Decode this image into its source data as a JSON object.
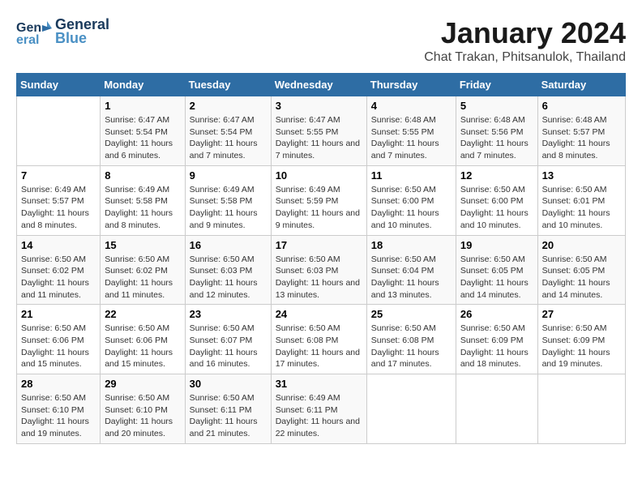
{
  "header": {
    "logo_line1": "General",
    "logo_line2": "Blue",
    "title": "January 2024",
    "subtitle": "Chat Trakan, Phitsanulok, Thailand"
  },
  "calendar": {
    "days_of_week": [
      "Sunday",
      "Monday",
      "Tuesday",
      "Wednesday",
      "Thursday",
      "Friday",
      "Saturday"
    ],
    "weeks": [
      [
        {
          "day": "",
          "info": ""
        },
        {
          "day": "1",
          "info": "Sunrise: 6:47 AM\nSunset: 5:54 PM\nDaylight: 11 hours and 6 minutes."
        },
        {
          "day": "2",
          "info": "Sunrise: 6:47 AM\nSunset: 5:54 PM\nDaylight: 11 hours and 7 minutes."
        },
        {
          "day": "3",
          "info": "Sunrise: 6:47 AM\nSunset: 5:55 PM\nDaylight: 11 hours and 7 minutes."
        },
        {
          "day": "4",
          "info": "Sunrise: 6:48 AM\nSunset: 5:55 PM\nDaylight: 11 hours and 7 minutes."
        },
        {
          "day": "5",
          "info": "Sunrise: 6:48 AM\nSunset: 5:56 PM\nDaylight: 11 hours and 7 minutes."
        },
        {
          "day": "6",
          "info": "Sunrise: 6:48 AM\nSunset: 5:57 PM\nDaylight: 11 hours and 8 minutes."
        }
      ],
      [
        {
          "day": "7",
          "info": "Sunrise: 6:49 AM\nSunset: 5:57 PM\nDaylight: 11 hours and 8 minutes."
        },
        {
          "day": "8",
          "info": "Sunrise: 6:49 AM\nSunset: 5:58 PM\nDaylight: 11 hours and 8 minutes."
        },
        {
          "day": "9",
          "info": "Sunrise: 6:49 AM\nSunset: 5:58 PM\nDaylight: 11 hours and 9 minutes."
        },
        {
          "day": "10",
          "info": "Sunrise: 6:49 AM\nSunset: 5:59 PM\nDaylight: 11 hours and 9 minutes."
        },
        {
          "day": "11",
          "info": "Sunrise: 6:50 AM\nSunset: 6:00 PM\nDaylight: 11 hours and 10 minutes."
        },
        {
          "day": "12",
          "info": "Sunrise: 6:50 AM\nSunset: 6:00 PM\nDaylight: 11 hours and 10 minutes."
        },
        {
          "day": "13",
          "info": "Sunrise: 6:50 AM\nSunset: 6:01 PM\nDaylight: 11 hours and 10 minutes."
        }
      ],
      [
        {
          "day": "14",
          "info": "Sunrise: 6:50 AM\nSunset: 6:02 PM\nDaylight: 11 hours and 11 minutes."
        },
        {
          "day": "15",
          "info": "Sunrise: 6:50 AM\nSunset: 6:02 PM\nDaylight: 11 hours and 11 minutes."
        },
        {
          "day": "16",
          "info": "Sunrise: 6:50 AM\nSunset: 6:03 PM\nDaylight: 11 hours and 12 minutes."
        },
        {
          "day": "17",
          "info": "Sunrise: 6:50 AM\nSunset: 6:03 PM\nDaylight: 11 hours and 13 minutes."
        },
        {
          "day": "18",
          "info": "Sunrise: 6:50 AM\nSunset: 6:04 PM\nDaylight: 11 hours and 13 minutes."
        },
        {
          "day": "19",
          "info": "Sunrise: 6:50 AM\nSunset: 6:05 PM\nDaylight: 11 hours and 14 minutes."
        },
        {
          "day": "20",
          "info": "Sunrise: 6:50 AM\nSunset: 6:05 PM\nDaylight: 11 hours and 14 minutes."
        }
      ],
      [
        {
          "day": "21",
          "info": "Sunrise: 6:50 AM\nSunset: 6:06 PM\nDaylight: 11 hours and 15 minutes."
        },
        {
          "day": "22",
          "info": "Sunrise: 6:50 AM\nSunset: 6:06 PM\nDaylight: 11 hours and 15 minutes."
        },
        {
          "day": "23",
          "info": "Sunrise: 6:50 AM\nSunset: 6:07 PM\nDaylight: 11 hours and 16 minutes."
        },
        {
          "day": "24",
          "info": "Sunrise: 6:50 AM\nSunset: 6:08 PM\nDaylight: 11 hours and 17 minutes."
        },
        {
          "day": "25",
          "info": "Sunrise: 6:50 AM\nSunset: 6:08 PM\nDaylight: 11 hours and 17 minutes."
        },
        {
          "day": "26",
          "info": "Sunrise: 6:50 AM\nSunset: 6:09 PM\nDaylight: 11 hours and 18 minutes."
        },
        {
          "day": "27",
          "info": "Sunrise: 6:50 AM\nSunset: 6:09 PM\nDaylight: 11 hours and 19 minutes."
        }
      ],
      [
        {
          "day": "28",
          "info": "Sunrise: 6:50 AM\nSunset: 6:10 PM\nDaylight: 11 hours and 19 minutes."
        },
        {
          "day": "29",
          "info": "Sunrise: 6:50 AM\nSunset: 6:10 PM\nDaylight: 11 hours and 20 minutes."
        },
        {
          "day": "30",
          "info": "Sunrise: 6:50 AM\nSunset: 6:11 PM\nDaylight: 11 hours and 21 minutes."
        },
        {
          "day": "31",
          "info": "Sunrise: 6:49 AM\nSunset: 6:11 PM\nDaylight: 11 hours and 22 minutes."
        },
        {
          "day": "",
          "info": ""
        },
        {
          "day": "",
          "info": ""
        },
        {
          "day": "",
          "info": ""
        }
      ]
    ]
  }
}
